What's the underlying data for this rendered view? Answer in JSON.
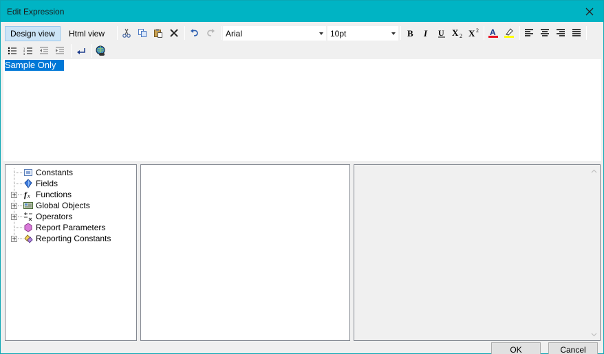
{
  "window": {
    "title": "Edit Expression"
  },
  "toolbar": {
    "design_view": "Design view",
    "html_view": "Html view",
    "font_name": "Arial",
    "font_size": "10pt",
    "icons": [
      "cut-icon",
      "copy-icon",
      "paste-icon",
      "delete-icon",
      "undo-icon",
      "redo-icon",
      "bold-icon",
      "italic-icon",
      "underline-icon",
      "subscript-icon",
      "superscript-icon",
      "font-color-icon",
      "highlight-icon",
      "align-left-icon",
      "align-center-icon",
      "align-right-icon",
      "justify-icon",
      "bullet-list-icon",
      "numbered-list-icon",
      "outdent-icon",
      "indent-icon",
      "line-break-icon",
      "hyperlink-icon"
    ],
    "colors": {
      "font_color": "#e81123",
      "highlight": "#ffff00"
    }
  },
  "editor": {
    "content": "Sample Only"
  },
  "tree": {
    "items": [
      {
        "label": "Constants",
        "icon": "constants-icon",
        "expandable": false
      },
      {
        "label": "Fields",
        "icon": "fields-icon",
        "expandable": false
      },
      {
        "label": "Functions",
        "icon": "function-icon",
        "expandable": true
      },
      {
        "label": "Global Objects",
        "icon": "global-objects-icon",
        "expandable": true
      },
      {
        "label": "Operators",
        "icon": "operators-icon",
        "expandable": true
      },
      {
        "label": "Report Parameters",
        "icon": "report-parameters-icon",
        "expandable": false
      },
      {
        "label": "Reporting Constants",
        "icon": "reporting-constants-icon",
        "expandable": true
      }
    ]
  },
  "buttons": {
    "ok": "OK",
    "cancel": "Cancel"
  },
  "colors": {
    "titlebar": "#00b4c4",
    "selection": "#0078d7",
    "active_tab": "#cce4f7"
  }
}
